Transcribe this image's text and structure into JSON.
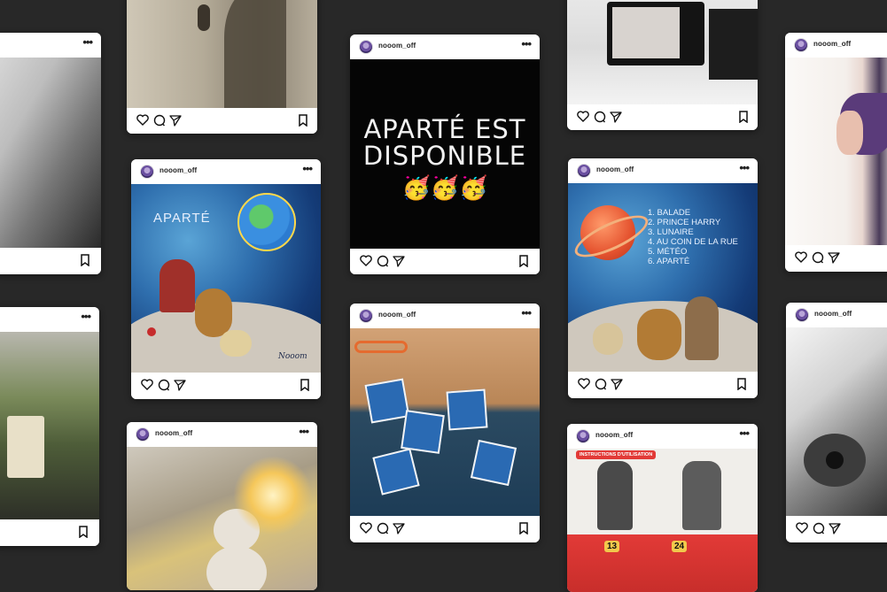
{
  "username": "nooom_off",
  "more_menu": "•••",
  "posts": {
    "p1": {
      "alt": "black-and-white-portrait-with-guitar"
    },
    "p2": {
      "alt": "singer-shadow-at-microphone"
    },
    "p3": {
      "alt": "aparte-cover-with-earth",
      "overlay_title": "APARTÉ",
      "signature": "Nooom"
    },
    "p4": {
      "overlay_line1": "APARTÉ EST",
      "overlay_line2": "DISPONIBLE",
      "emoji": "🥳🥳🥳"
    },
    "p5": {
      "alt": "studio-camera-screen"
    },
    "p6": {
      "tracks": [
        "1. BALADE",
        "2. PRINCE HARRY",
        "3. LUNAIRE",
        "4. AU COIN DE LA RUE",
        "5. MÉTÉO",
        "6. APARTÉ"
      ]
    },
    "p7": {
      "alt": "portrait-profile-purple-hair"
    },
    "p8": {
      "alt": "tote-bag-hanging-outdoors"
    },
    "p9": {
      "alt": "aparte-cd-booklets-on-desk"
    },
    "p10": {
      "alt": "teddy-bear-in-snow-with-fire"
    },
    "p11": {
      "alt": "duo-on-laundromat-machines",
      "sign_text": "INSTRUCTIONS D'UTILISATION",
      "machine_numbers": [
        "13",
        "24"
      ]
    },
    "p12": {
      "alt": "black-and-white-guitar-player"
    }
  },
  "colors": {
    "background": "#282828",
    "card": "#ffffff"
  }
}
